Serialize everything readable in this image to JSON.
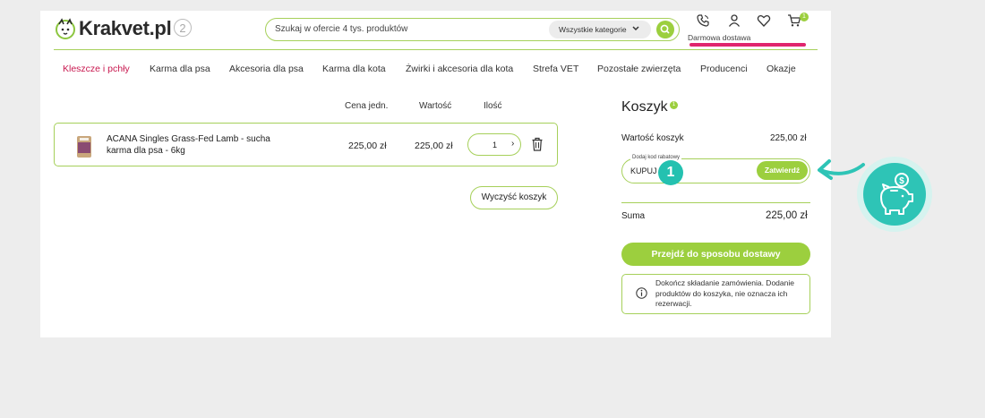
{
  "header": {
    "logo_text": "Krakvet.pl",
    "logo_badge": "2",
    "search_placeholder": "Szukaj w ofercie 4 tys. produktów",
    "category_select": "Wszystkie kategorie",
    "cart_count": "1",
    "delivery_label": "Darmowa dostawa"
  },
  "nav": {
    "items": [
      "Kleszcze i pchły",
      "Karma dla psa",
      "Akcesoria dla psa",
      "Karma dla kota",
      "Żwirki i akcesoria dla kota",
      "Strefa VET",
      "Pozostałe zwierzęta",
      "Producenci",
      "Okazje"
    ]
  },
  "cart_table": {
    "headers": {
      "unit_price": "Cena jedn.",
      "value": "Wartość",
      "quantity": "Ilość"
    },
    "items": [
      {
        "name": "ACANA Singles Grass-Fed Lamb - sucha karma dla psa - 6kg",
        "unit_price": "225,00 zł",
        "value": "225,00 zł",
        "quantity": "1"
      }
    ],
    "clear_button": "Wyczyść koszyk"
  },
  "summary": {
    "title": "Koszyk",
    "count_badge": "1",
    "cart_value_label": "Wartość koszyk",
    "cart_value": "225,00 zł",
    "promo_label": "Dodaj kod rabatowy",
    "promo_value": "KUPUJ",
    "promo_apply": "Zatwierdź",
    "total_label": "Suma",
    "total_value": "225,00 zł",
    "checkout_button": "Przejdź do sposobu dostawy",
    "info_text": "Dokończ składanie zamówienia. Dodanie produktów do koszyka, nie oznacza ich rezerwacji."
  },
  "annotation": {
    "step_number": "1",
    "icon": "piggy-bank-coin-icon",
    "color": "#2ec4b6"
  },
  "colors": {
    "brand_green": "#9ccf3e",
    "accent_pink": "#e0256e",
    "nav_active": "#c8184f",
    "teal": "#24c1b0"
  }
}
